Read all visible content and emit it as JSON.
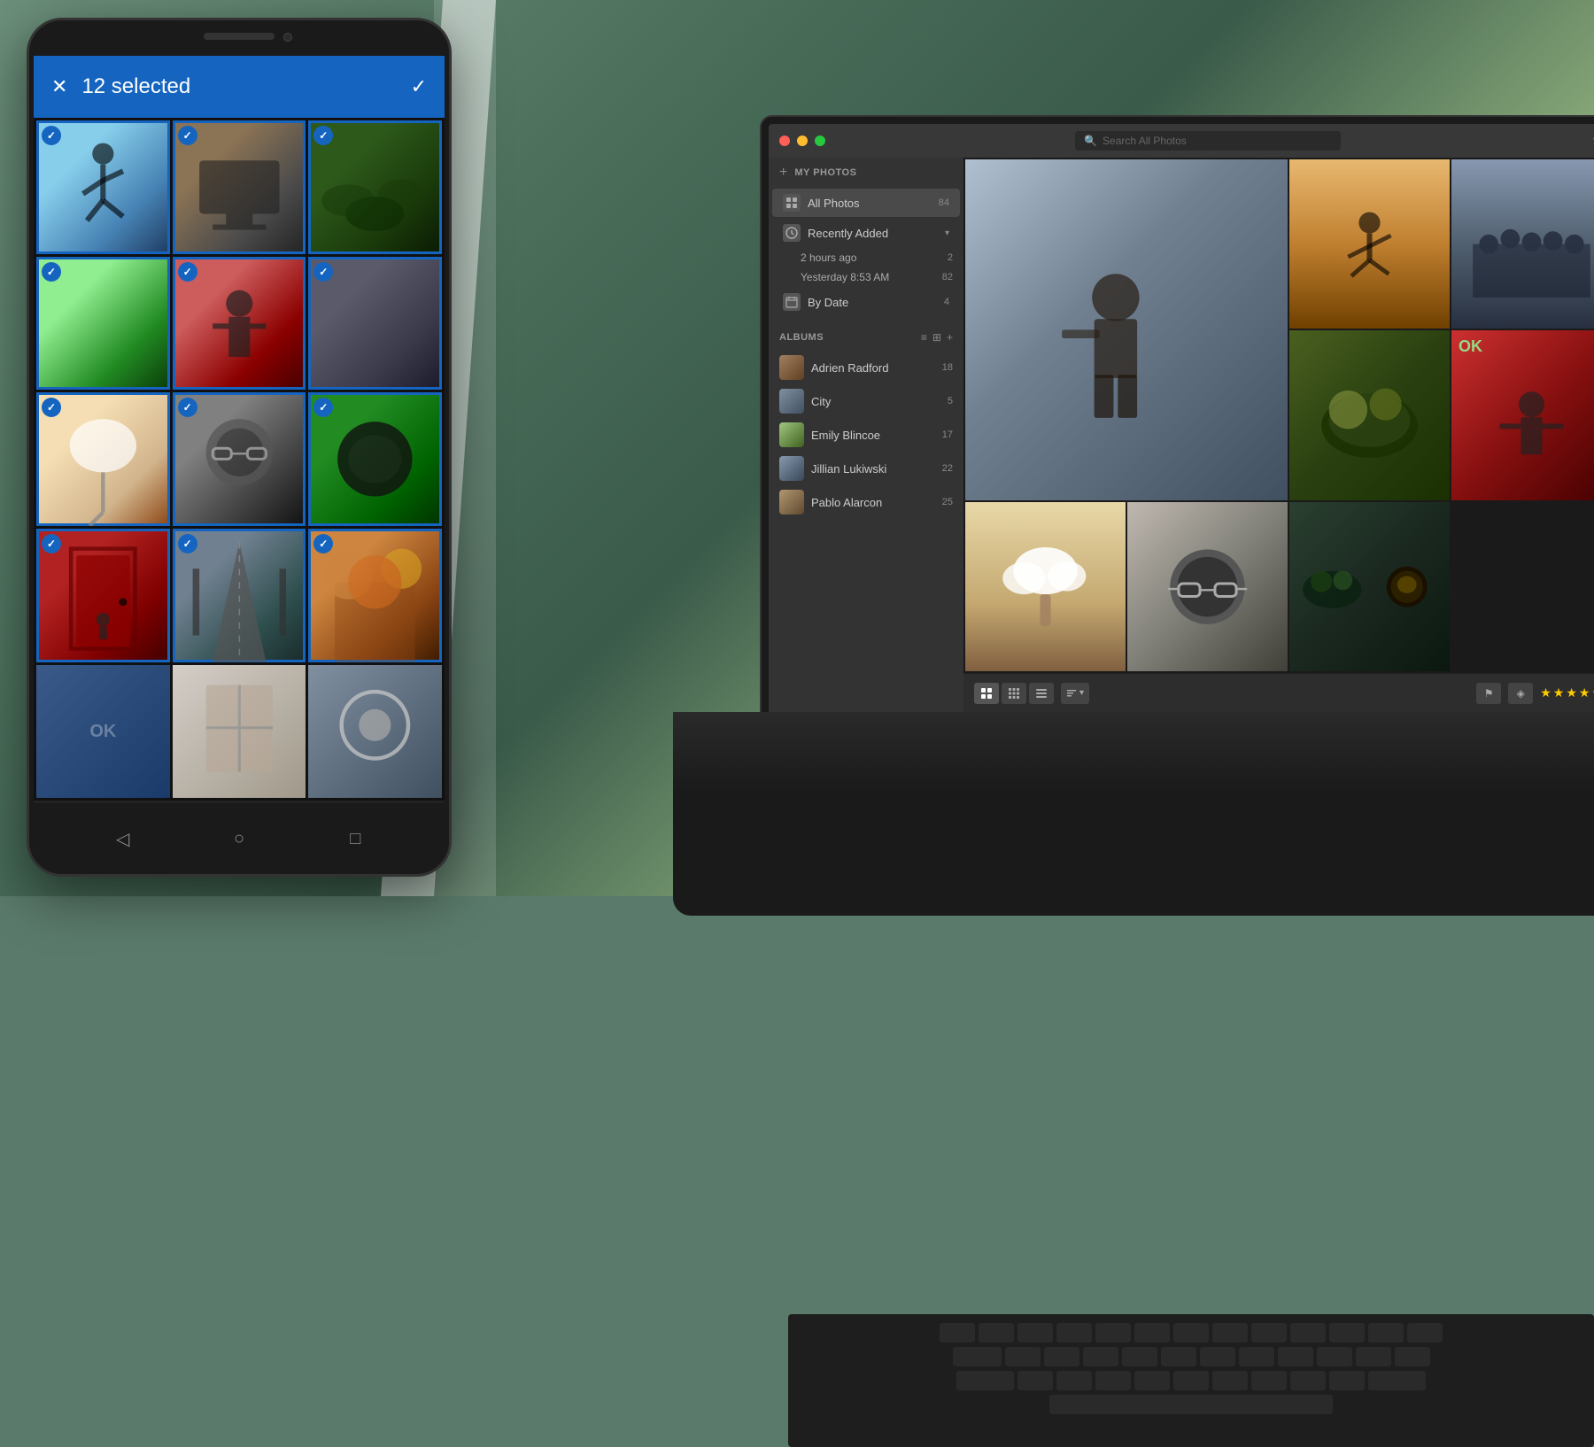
{
  "background": {
    "gradient_start": "#6b8f7a",
    "gradient_end": "#4a6e5a"
  },
  "phone": {
    "selected_count": "12 selected",
    "close_icon": "✕",
    "check_icon": "✓",
    "nav": {
      "back_icon": "◁",
      "home_icon": "○",
      "recent_icon": "□"
    },
    "photos": [
      {
        "id": 1,
        "color_class": "p1",
        "selected": true,
        "label": "jump photo"
      },
      {
        "id": 2,
        "color_class": "p2",
        "selected": true,
        "label": "tv photo"
      },
      {
        "id": 3,
        "color_class": "p3",
        "selected": true,
        "label": "food photo"
      },
      {
        "id": 4,
        "color_class": "p4",
        "selected": true,
        "label": "green photo"
      },
      {
        "id": 5,
        "color_class": "p5",
        "selected": true,
        "label": "red wall photo"
      },
      {
        "id": 6,
        "color_class": "p6",
        "selected": true,
        "label": "dark photo"
      },
      {
        "id": 7,
        "color_class": "p7",
        "selected": true,
        "label": "cloud photo"
      },
      {
        "id": 8,
        "color_class": "p8",
        "selected": true,
        "label": "portrait photo"
      },
      {
        "id": 9,
        "color_class": "p9",
        "selected": true,
        "label": "circle photo"
      },
      {
        "id": 10,
        "color_class": "p10",
        "selected": true,
        "label": "door photo"
      },
      {
        "id": 11,
        "color_class": "p11",
        "selected": true,
        "label": "road photo"
      },
      {
        "id": 12,
        "color_class": "p12",
        "selected": true,
        "label": "autumn photo"
      },
      {
        "id": 13,
        "color_class": "p1",
        "selected": false,
        "label": "graffiti photo"
      },
      {
        "id": 14,
        "color_class": "p8",
        "selected": false,
        "label": "window photo"
      },
      {
        "id": 15,
        "color_class": "p11",
        "selected": false,
        "label": "tree photo"
      }
    ]
  },
  "laptop": {
    "titlebar": {
      "traffic_red": "#FF5F57",
      "traffic_yellow": "#FFBD2E",
      "traffic_green": "#28C840"
    },
    "search": {
      "placeholder": "Search All Photos",
      "icon": "🔍"
    },
    "filter_icon": "▼",
    "sidebar": {
      "my_photos_label": "MY PHOTOS",
      "add_icon": "+",
      "items": [
        {
          "icon": "📷",
          "label": "All Photos",
          "count": "84",
          "active": true
        }
      ],
      "recently_added": {
        "label": "Recently Added",
        "expand_icon": "▾",
        "sub_items": [
          {
            "label": "2 hours ago",
            "count": "2"
          },
          {
            "label": "Yesterday 8:53 AM",
            "count": "82"
          }
        ]
      },
      "by_date": {
        "label": "By Date",
        "count": "4"
      },
      "albums_label": "ALBUMS",
      "albums_grid_icon": "⊞",
      "albums_list_icon": "≡",
      "albums_add_icon": "+",
      "albums": [
        {
          "name": "Adrien Radford",
          "count": "18",
          "color": "#8a7a6a"
        },
        {
          "name": "City",
          "count": "5",
          "color": "#607080"
        },
        {
          "name": "Emily Blincoe",
          "count": "17",
          "color": "#a8c888"
        },
        {
          "name": "Jillian Lukiwski",
          "count": "22",
          "color": "#88a0b8"
        },
        {
          "name": "Pablo Alarcon",
          "count": "25",
          "color": "#9a8870"
        }
      ]
    },
    "toolbar": {
      "view_buttons": [
        "⊞",
        "⊟",
        "≡"
      ],
      "sort_label": "≡ ▾",
      "flag_icon": "⚑",
      "filter_icon": "◈",
      "stars": [
        true,
        true,
        true,
        true,
        true
      ]
    }
  }
}
